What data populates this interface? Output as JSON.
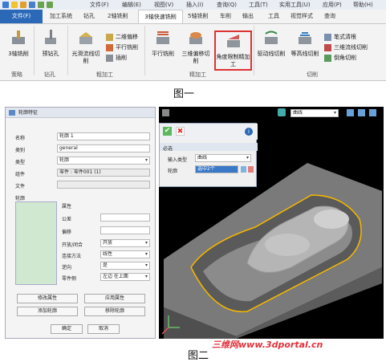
{
  "fig1": {
    "menu": [
      "文件(F)",
      "编辑(E)",
      "视图(V)",
      "插入(I)",
      "查询(Q)",
      "工具(T)",
      "实用工具(U)",
      "应用(P)",
      "帮助(H)"
    ],
    "file_tab": "文件(F)",
    "tabs": [
      "加工系统",
      "钻孔",
      "2轴铣削",
      "3轴快速铣削",
      "5轴铣削",
      "车削",
      "输出",
      "工具",
      "视觉样式",
      "查询"
    ],
    "active_tab": "3轴快速铣削",
    "buttons": {
      "mill3": "3轴铣削",
      "predrill": "预钻孔",
      "smooth_flow": "光滑流线切削",
      "twod_offset": "二维偏移",
      "parallel_cut": "平行铣削",
      "plunge": "插削",
      "parallel_mill": "平行铣削",
      "threed_offset": "三维偏移切削",
      "angle_limit": "角度限制精加工",
      "drive_cut": "驱动线切削",
      "contour_cut": "等高线切削",
      "pencil": "笔式清根",
      "flowline3d": "三维流线切削",
      "chamfer": "倒角切削"
    },
    "groups": {
      "policy": "策略",
      "drill": "钻孔",
      "rough": "粗加工",
      "finish": "精加工",
      "cut": "切削"
    },
    "caption": "图一"
  },
  "fig2": {
    "dialog": {
      "title": "轮廓特征",
      "rows": [
        {
          "label": "名称",
          "value": "轮廓 1"
        },
        {
          "label": "类别",
          "value": "general"
        },
        {
          "label": "类型",
          "value": "轮廓"
        },
        {
          "label": "组件",
          "value": "零件 : 零件001 (1)"
        },
        {
          "label": "文件",
          "value": ""
        }
      ],
      "list_label": "轮廓",
      "props_header": "属性",
      "props": [
        {
          "label": "公差",
          "value": ""
        },
        {
          "label": "偏移",
          "value": ""
        },
        {
          "label": "开放/闭合",
          "value": "开放"
        },
        {
          "label": "连接方法",
          "value": "线性"
        },
        {
          "label": "逆向",
          "value": "是"
        },
        {
          "label": "零件侧",
          "value": "左边 在上面"
        }
      ],
      "buttons": {
        "modify": "修改属性",
        "apply": "应用属性",
        "add": "添加轮廓",
        "remove": "移除轮廓",
        "ok": "确定",
        "cancel": "取消"
      }
    },
    "viewport": {
      "select_value": "曲线",
      "section": "必选",
      "input_type_label": "输入类型",
      "input_type_value": "曲线",
      "contour_label": "轮廓",
      "contour_value": "选中2个"
    },
    "caption": "图二"
  },
  "watermark": "三维网www.3dportal.cn",
  "colors": {
    "accent_blue": "#2b68b8",
    "highlight_red": "#d33333",
    "list_green": "#cfe8cf",
    "contour_yellow": "#f5b800"
  }
}
